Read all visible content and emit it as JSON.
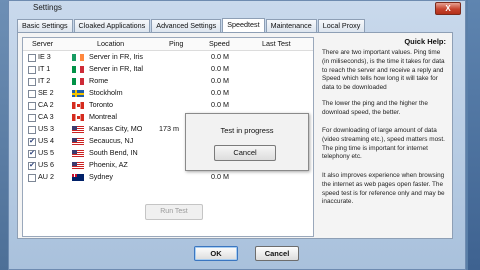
{
  "window": {
    "title": "Settings",
    "close_label": "X"
  },
  "tabs": [
    "Basic Settings",
    "Cloaked Applications",
    "Advanced Settings",
    "Speedtest",
    "Maintenance",
    "Local Proxy"
  ],
  "active_tab": "Speedtest",
  "columns": {
    "server": "Server",
    "location": "Location",
    "ping": "Ping",
    "speed": "Speed",
    "last_test": "Last Test"
  },
  "servers": [
    {
      "code": "IE 3",
      "flag": "ie-flag-icon",
      "location": "Server in FR, Iris",
      "ping": "",
      "speed": "0.0 M",
      "checked": false
    },
    {
      "code": "IT 1",
      "flag": "it-flag-icon",
      "location": "Server in FR, Ital",
      "ping": "",
      "speed": "0.0 M",
      "checked": false
    },
    {
      "code": "IT 2",
      "flag": "it-flag-icon",
      "location": "Rome",
      "ping": "",
      "speed": "0.0 M",
      "checked": false
    },
    {
      "code": "SE 2",
      "flag": "se-flag-icon",
      "location": "Stockholm",
      "ping": "",
      "speed": "0.0 M",
      "checked": false
    },
    {
      "code": "CA 2",
      "flag": "ca-flag-icon",
      "location": "Toronto",
      "ping": "",
      "speed": "0.0 M",
      "checked": false
    },
    {
      "code": "CA 3",
      "flag": "ca-flag-icon",
      "location": "Montreal",
      "ping": "",
      "speed": "",
      "checked": false
    },
    {
      "code": "US 3",
      "flag": "us-flag-icon",
      "location": "Kansas City, MO",
      "ping": "173 m",
      "speed": "",
      "checked": false
    },
    {
      "code": "US 4",
      "flag": "us-flag-icon",
      "location": "Secaucus, NJ",
      "ping": "",
      "speed": "",
      "checked": true
    },
    {
      "code": "US 5",
      "flag": "us-flag-icon",
      "location": "South Bend, IN",
      "ping": "",
      "speed": "",
      "checked": true
    },
    {
      "code": "US 6",
      "flag": "us-flag-icon",
      "location": "Phoenix, AZ",
      "ping": "",
      "speed": "",
      "checked": true
    },
    {
      "code": "AU 2",
      "flag": "au-flag-icon",
      "location": "Sydney",
      "ping": "",
      "speed": "0.0 M",
      "checked": false
    }
  ],
  "run_test_label": "Run Test",
  "modal": {
    "text": "Test in progress",
    "cancel_label": "Cancel"
  },
  "help": {
    "title": "Quick Help:",
    "p1": "There are two important values. Ping time (in miliseconds), is the time it takes for data to reach the server and receive a reply and Speed which tells how long it will take for data to be downloaded",
    "p2": "The lower the ping and the higher the download speed, the better.",
    "p3": "For downloading of large amount of data (video streaming etc.), speed matters most. The ping time is important for internet telephony etc.",
    "p4": "It also improves experience when browsing the internet as web pages open faster. The speed test is for reference only and may be inaccurate."
  },
  "buttons": {
    "ok": "OK",
    "cancel": "Cancel"
  }
}
